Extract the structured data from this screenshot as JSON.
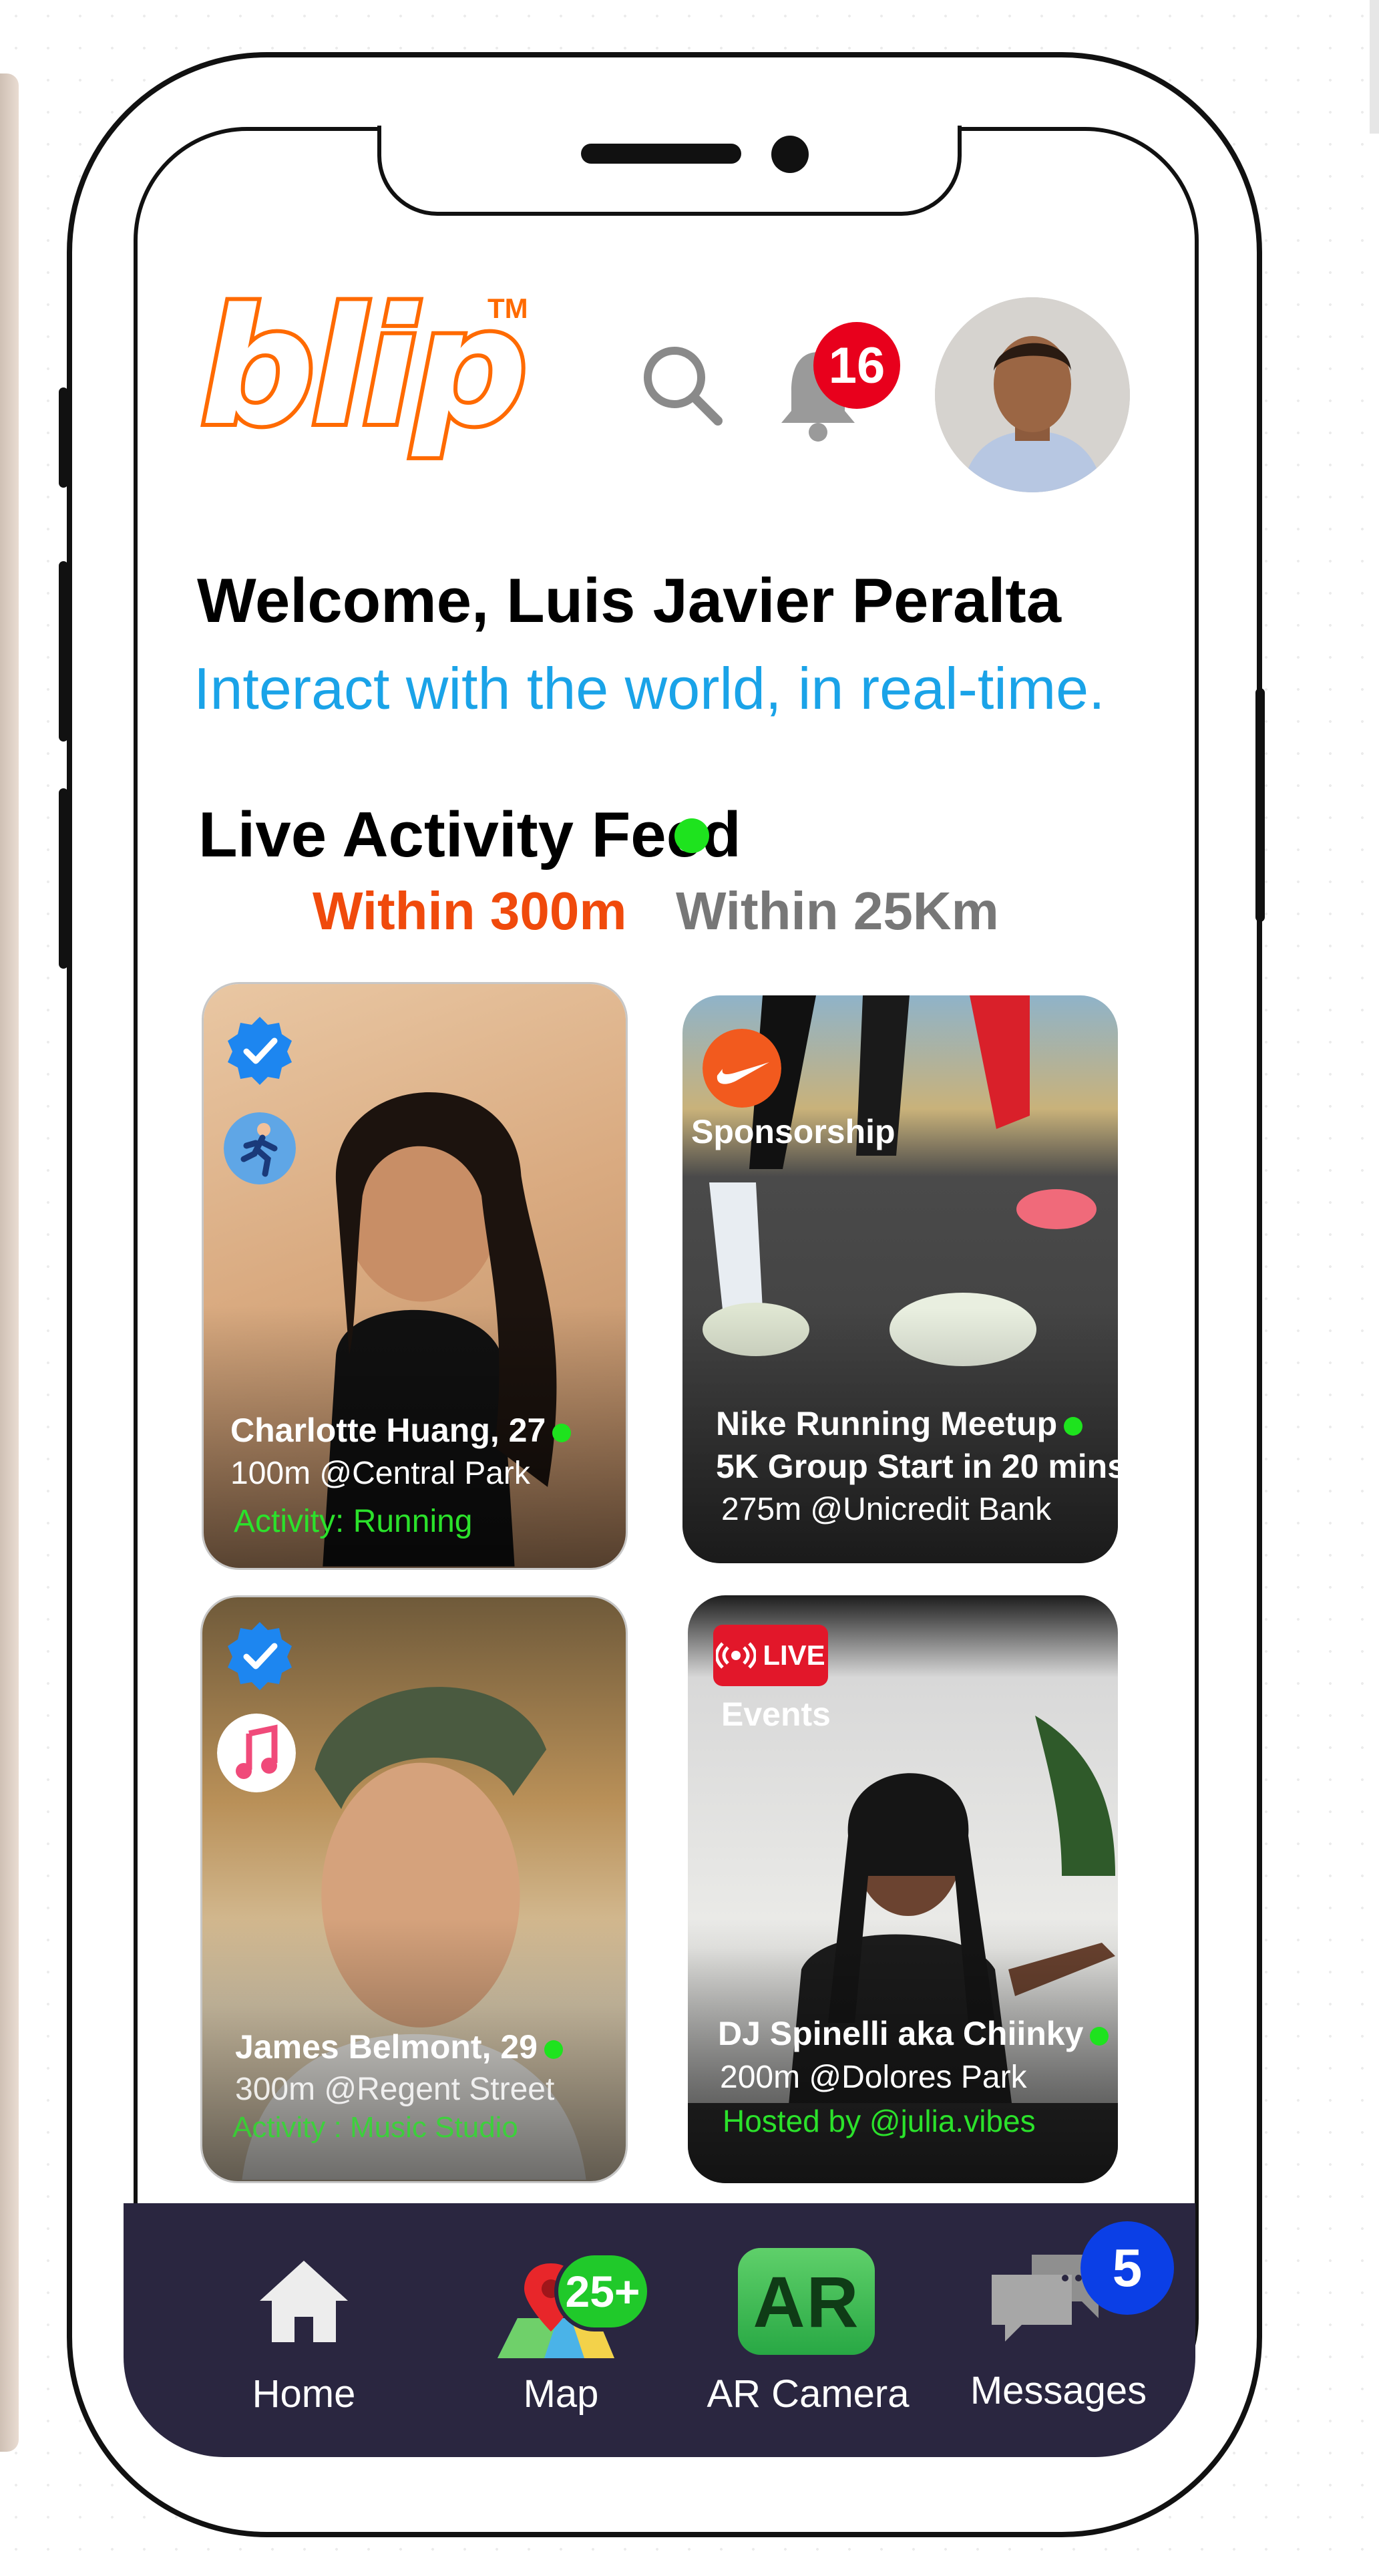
{
  "app": {
    "logo_text": "blip",
    "trademark": "TM"
  },
  "header": {
    "notification_count": "16"
  },
  "welcome": {
    "title": "Welcome, Luis Javier Peralta",
    "tagline": "Interact with the world, in real-time."
  },
  "feed": {
    "title": "Live Activity Feed",
    "tabs": [
      {
        "label": "Within 300m",
        "active": true
      },
      {
        "label": "Within 25Km",
        "active": false
      }
    ],
    "cards": [
      {
        "name": "Charlotte Huang, 27",
        "location": "100m @Central Park",
        "activity": "Activity: Running",
        "verified": true,
        "activity_icon": "runner-icon"
      },
      {
        "tag": "Sponsorship",
        "name": "Nike Running Meetup",
        "detail": "5K Group Start in 20 mins",
        "location": "275m @Unicredit Bank",
        "brand_icon": "nike-swoosh-icon"
      },
      {
        "name": "James Belmont, 29",
        "location": "300m @Regent Street",
        "activity": "Activity : Music Studio",
        "verified": true,
        "activity_icon": "music-note-icon"
      },
      {
        "tag": "Events",
        "live_label": "LIVE",
        "name": "DJ Spinelli aka Chiinky",
        "location": "200m @Dolores Park",
        "host": "Hosted by @julia.vibes"
      }
    ]
  },
  "nav": {
    "items": [
      {
        "label": "Home",
        "icon": "home-icon"
      },
      {
        "label": "Map",
        "icon": "map-pin-icon",
        "badge": "25+"
      },
      {
        "label": "AR Camera",
        "icon": "ar-icon",
        "icon_text": "AR"
      },
      {
        "label": "Messages",
        "icon": "chat-bubbles-icon",
        "badge": "5"
      }
    ]
  },
  "colors": {
    "brand_orange": "#ff6a00",
    "accent_blue": "#1aa3e8",
    "live_green": "#1ee31e",
    "nav_bg": "#2a2640"
  }
}
